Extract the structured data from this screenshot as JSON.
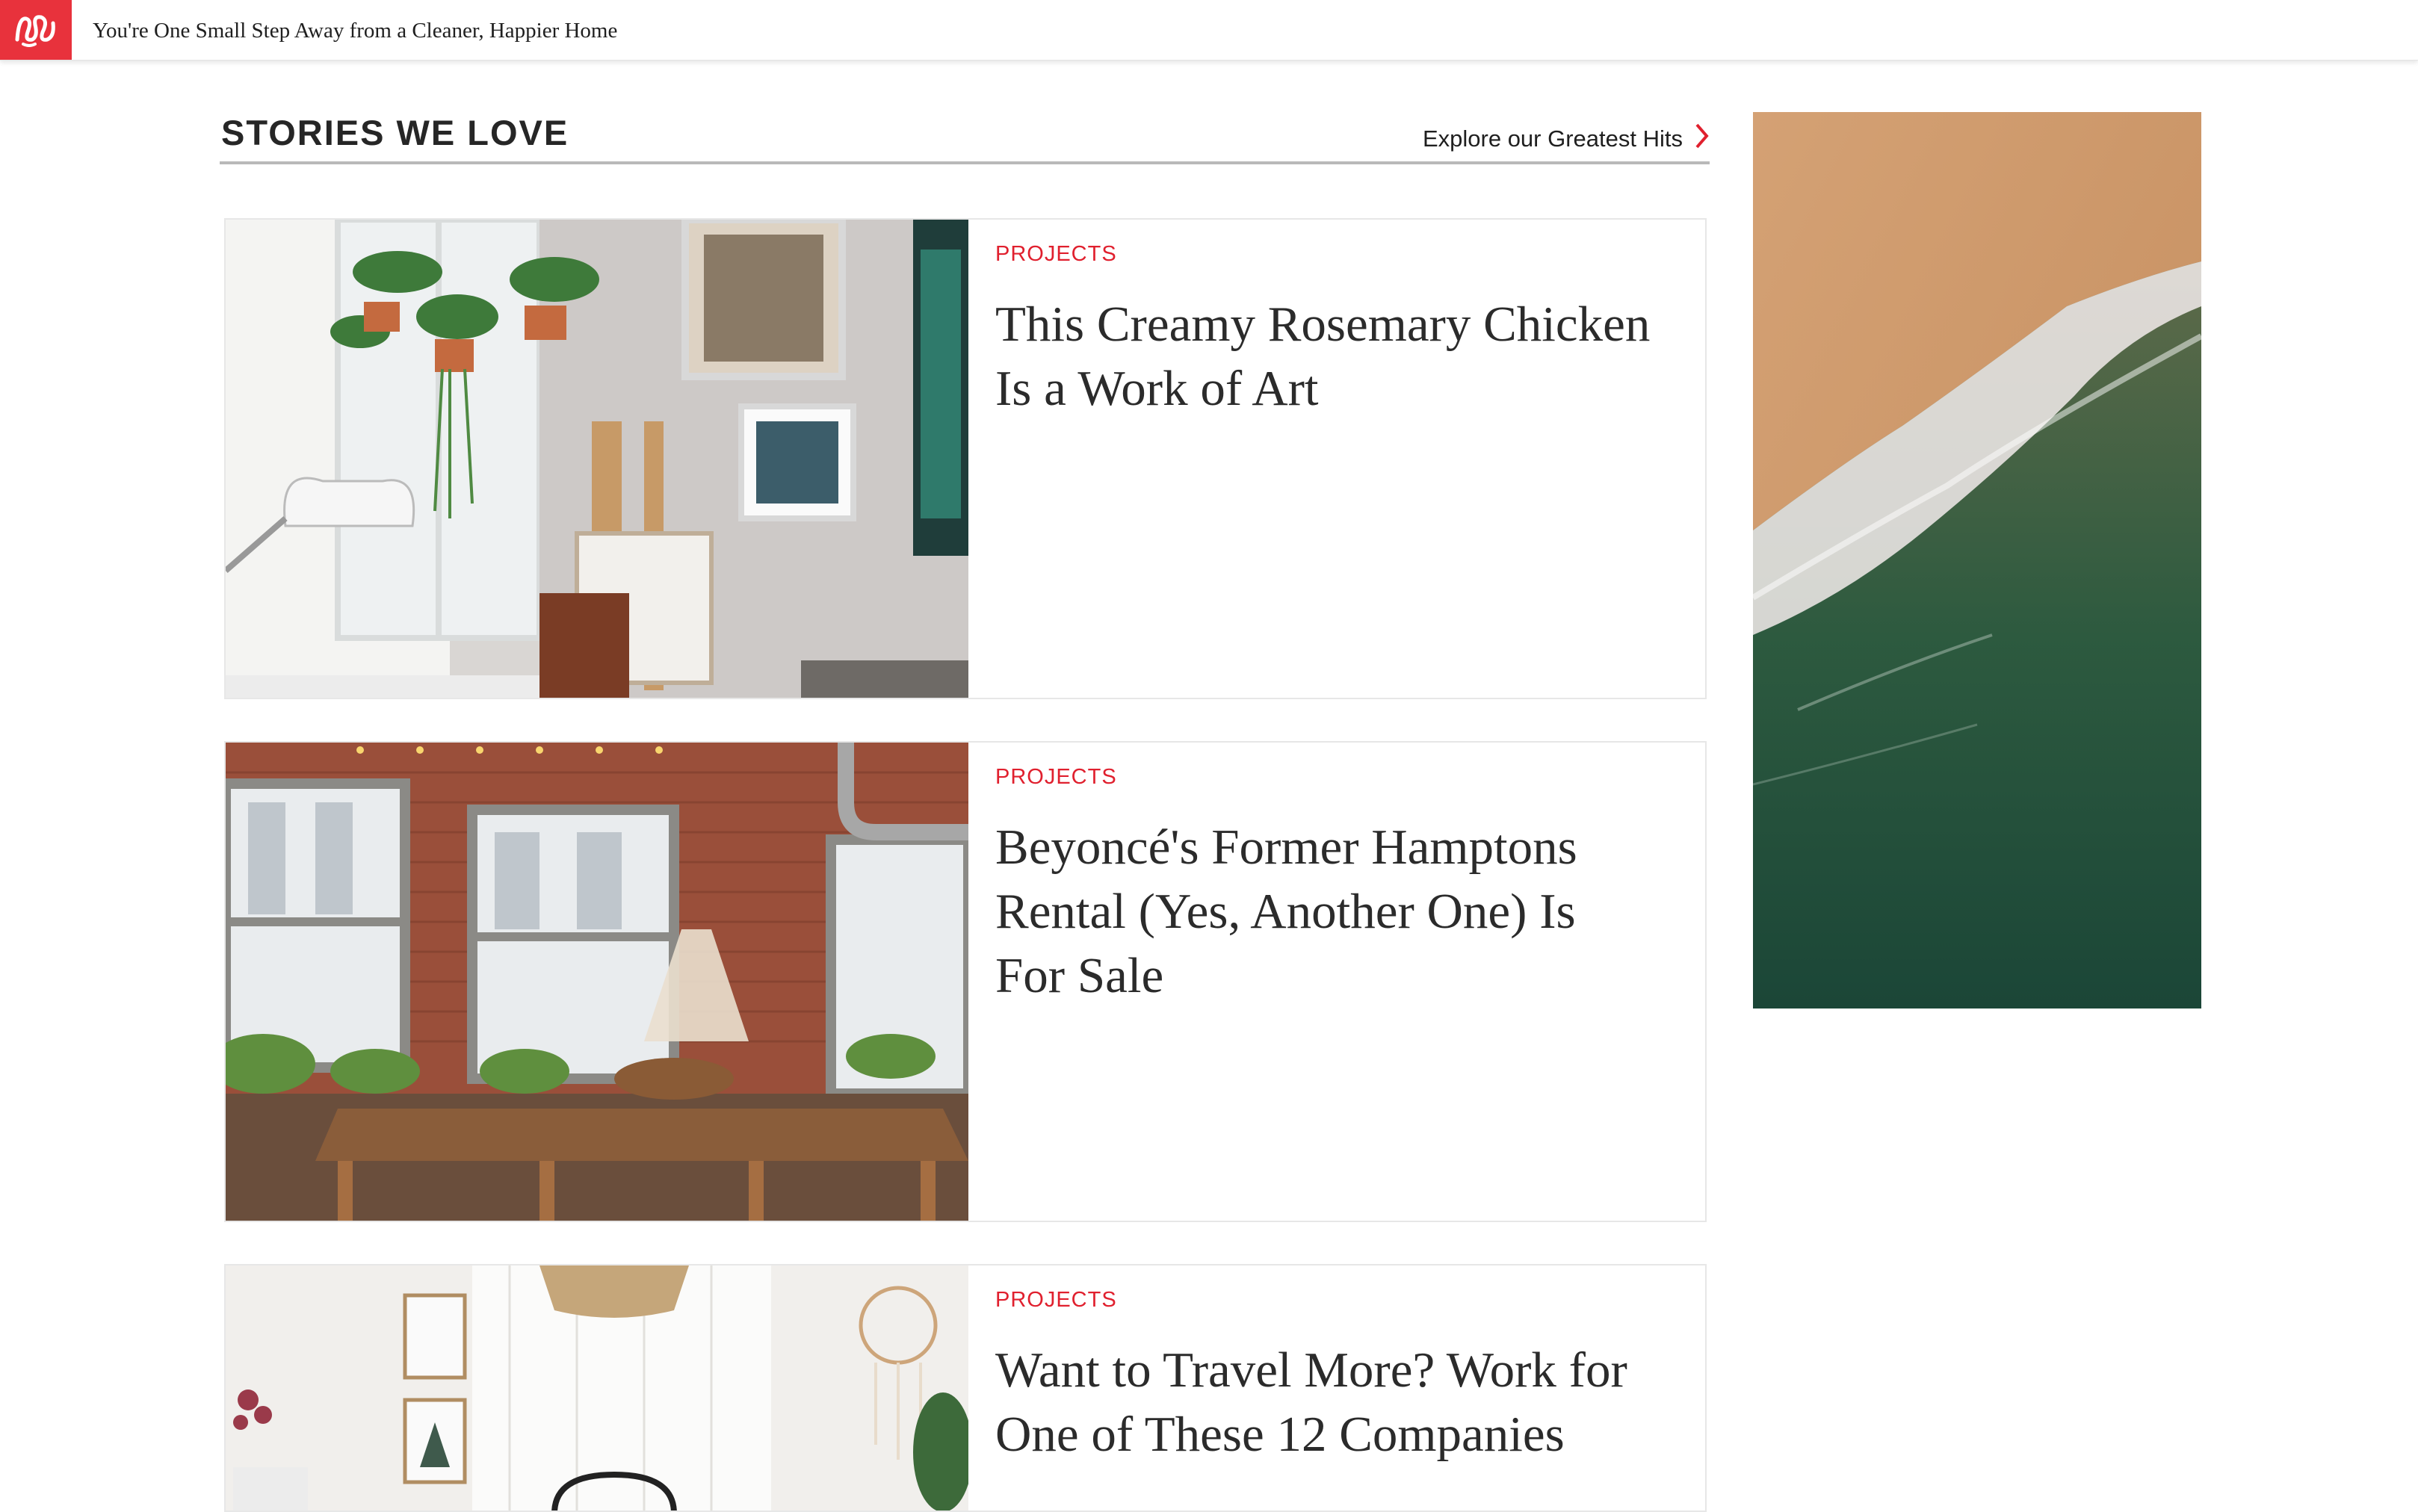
{
  "topbar": {
    "logo_icon": "wm-squiggle-logo-icon",
    "brand_color": "#e8323c",
    "title": "You're One Small Step Away from a Cleaner, Happier Home"
  },
  "section": {
    "title": "STORIES WE LOVE",
    "explore_label": "Explore our Greatest Hits",
    "explore_icon": "chevron-right-icon",
    "accent_color": "#e0202e"
  },
  "stories": [
    {
      "category": "PROJECTS",
      "headline": "This Creamy Rosemary Chicken Is a Work of Art",
      "image": "plant-filled-art-studio-photo"
    },
    {
      "category": "PROJECTS",
      "headline": "Beyoncé's Former Hamptons Rental (Yes, Another One) Is For Sale",
      "image": "brick-loft-dining-room-photo"
    },
    {
      "category": "PROJECTS",
      "headline": "Want to Travel More? Work for One of These 12 Companies",
      "image": "bright-bedroom-photo"
    }
  ],
  "side_ad": {
    "image": "aerial-beach-wave-photo"
  }
}
